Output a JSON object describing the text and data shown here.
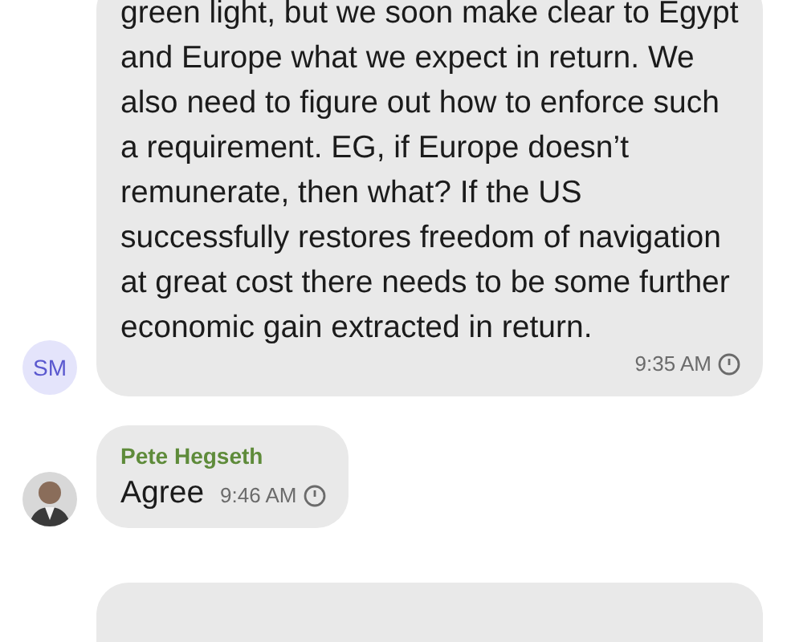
{
  "messages": [
    {
      "kind": "text",
      "avatar": {
        "kind": "initials",
        "text": "SM"
      },
      "body": "green light, but we soon make clear to Egypt and Europe what we expect in return. We also need to figure out how to enforce such a requirement. EG, if Europe doesn’t remunerate, then what? If the US successfully restores freedom of navigation at great cost there needs to be some further economic gain extracted in return.",
      "time": "9:35 AM"
    },
    {
      "kind": "text",
      "avatar": {
        "kind": "figure"
      },
      "sender": "Pete Hegseth",
      "color": "#5e8b3a",
      "body": "Agree",
      "time": "9:46 AM"
    },
    {
      "kind": "cut_off"
    }
  ]
}
